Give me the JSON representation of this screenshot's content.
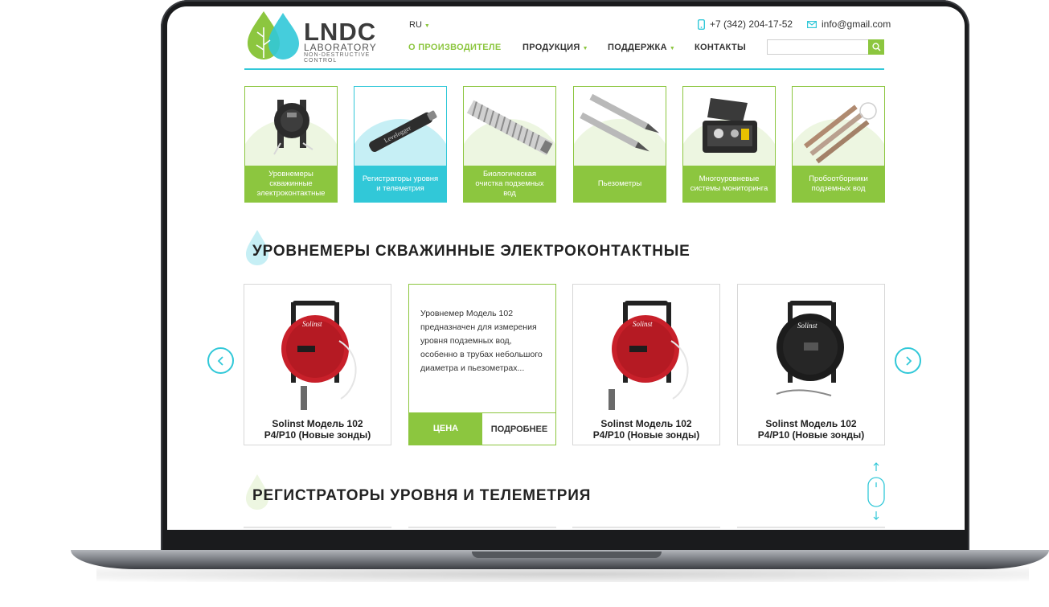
{
  "header": {
    "logo": {
      "title": "LNDC",
      "subtitle": "LABORATORY",
      "tagline": "NON-DESTRUCTIVE CONTROL"
    },
    "lang": "RU",
    "phone": "+7 (342) 204-17-52",
    "email": "info@gmail.com"
  },
  "nav": {
    "items": [
      {
        "label": "О ПРОИЗВОДИТЕЛЕ",
        "active": true
      },
      {
        "label": "ПРОДУКЦИЯ",
        "dropdown": true
      },
      {
        "label": "ПОДДЕРЖКА",
        "dropdown": true
      },
      {
        "label": "КОНТАКТЫ"
      }
    ]
  },
  "search": {
    "value": "",
    "placeholder": ""
  },
  "categories": [
    {
      "label": "Уровнемеры скважинные электроконтактные",
      "icon": "cable-reel-icon"
    },
    {
      "label": "Регистраторы уровня и телеметрия",
      "icon": "levelogger-icon"
    },
    {
      "label": "Биологическая очистка подземных вод",
      "icon": "screen-pipe-icon"
    },
    {
      "label": "Пьезометры",
      "icon": "piezometer-icon"
    },
    {
      "label": "Многоуровневые системы мониторинга",
      "icon": "monitoring-case-icon"
    },
    {
      "label": "Пробоотборники подземных вод",
      "icon": "sampler-icon"
    }
  ],
  "sections": [
    {
      "title": "УРОВНЕМЕРЫ СКВАЖИННЫЕ ЭЛЕКТРОКОНТАКТНЫЕ"
    },
    {
      "title": "РЕГИСТРАТОРЫ УРОВНЯ И ТЕЛЕМЕТРИЯ"
    }
  ],
  "products": [
    {
      "title_line1": "Solinst Модель 102",
      "title_line2": "P4/P10 (Новые зонды)",
      "reel_color": "#c8202a"
    },
    {
      "description": "Уровнемер Модель 102 предназначен для измерения уровня подземных вод, особенно в трубах небольшого диаметра и пьезометрах...",
      "price_label": "ЦЕНА",
      "more_label": "ПОДРОБНЕЕ"
    },
    {
      "title_line1": "Solinst Модель 102",
      "title_line2": "P4/P10 (Новые зонды)",
      "reel_color": "#c8202a"
    },
    {
      "title_line1": "Solinst Модель 102",
      "title_line2": "P4/P10 (Новые зонды)",
      "reel_color": "#1c1c1c"
    }
  ],
  "colors": {
    "green": "#8cc63f",
    "cyan": "#31c8d8"
  }
}
